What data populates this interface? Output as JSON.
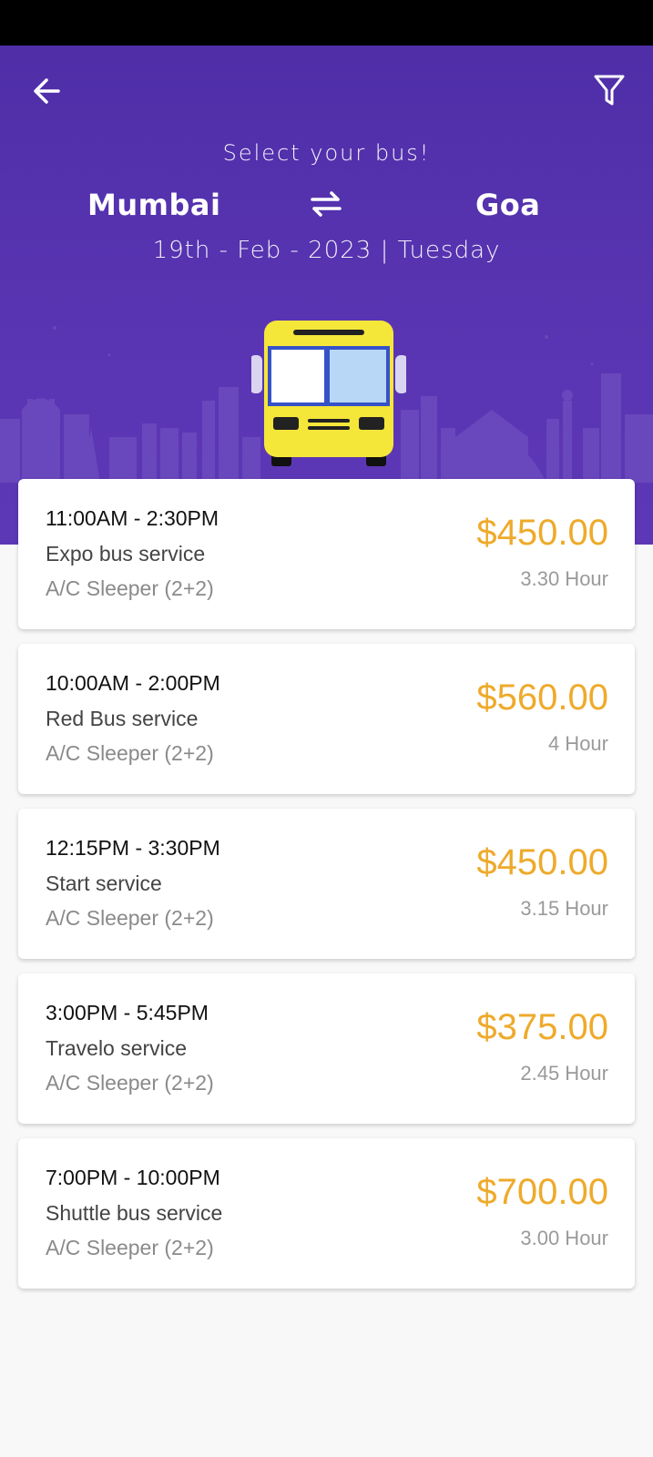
{
  "header": {
    "subtitle": "Select your bus!",
    "from_city": "Mumbai",
    "to_city": "Goa",
    "date": "19th - Feb - 2023 | Tuesday",
    "back_icon": "arrow-left",
    "filter_icon": "filter-funnel",
    "swap_icon": "swap-arrows"
  },
  "colors": {
    "header_bg": "#5333ae",
    "price": "#eeaa2b",
    "bus_body": "#f5e63a"
  },
  "buses": [
    {
      "time": "11:00AM - 2:30PM",
      "name": "Expo bus service",
      "type": "A/C Sleeper (2+2)",
      "price": "$450.00",
      "duration": "3.30 Hour"
    },
    {
      "time": "10:00AM - 2:00PM",
      "name": "Red Bus service",
      "type": "A/C Sleeper (2+2)",
      "price": "$560.00",
      "duration": "4 Hour"
    },
    {
      "time": "12:15PM - 3:30PM",
      "name": "Start service",
      "type": "A/C Sleeper (2+2)",
      "price": "$450.00",
      "duration": "3.15 Hour"
    },
    {
      "time": "3:00PM - 5:45PM",
      "name": "Travelo service",
      "type": "A/C Sleeper (2+2)",
      "price": "$375.00",
      "duration": "2.45 Hour"
    },
    {
      "time": "7:00PM - 10:00PM",
      "name": "Shuttle bus service",
      "type": "A/C Sleeper (2+2)",
      "price": "$700.00",
      "duration": "3.00 Hour"
    }
  ]
}
